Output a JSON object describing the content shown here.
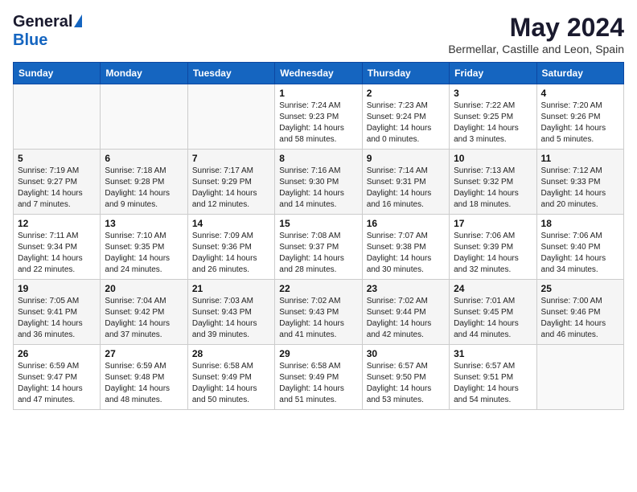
{
  "header": {
    "logo_general": "General",
    "logo_blue": "Blue",
    "month_year": "May 2024",
    "location": "Bermellar, Castille and Leon, Spain"
  },
  "weekdays": [
    "Sunday",
    "Monday",
    "Tuesday",
    "Wednesday",
    "Thursday",
    "Friday",
    "Saturday"
  ],
  "weeks": [
    [
      {
        "day": "",
        "info": ""
      },
      {
        "day": "",
        "info": ""
      },
      {
        "day": "",
        "info": ""
      },
      {
        "day": "1",
        "info": "Sunrise: 7:24 AM\nSunset: 9:23 PM\nDaylight: 14 hours\nand 58 minutes."
      },
      {
        "day": "2",
        "info": "Sunrise: 7:23 AM\nSunset: 9:24 PM\nDaylight: 14 hours\nand 0 minutes."
      },
      {
        "day": "3",
        "info": "Sunrise: 7:22 AM\nSunset: 9:25 PM\nDaylight: 14 hours\nand 3 minutes."
      },
      {
        "day": "4",
        "info": "Sunrise: 7:20 AM\nSunset: 9:26 PM\nDaylight: 14 hours\nand 5 minutes."
      }
    ],
    [
      {
        "day": "5",
        "info": "Sunrise: 7:19 AM\nSunset: 9:27 PM\nDaylight: 14 hours\nand 7 minutes."
      },
      {
        "day": "6",
        "info": "Sunrise: 7:18 AM\nSunset: 9:28 PM\nDaylight: 14 hours\nand 9 minutes."
      },
      {
        "day": "7",
        "info": "Sunrise: 7:17 AM\nSunset: 9:29 PM\nDaylight: 14 hours\nand 12 minutes."
      },
      {
        "day": "8",
        "info": "Sunrise: 7:16 AM\nSunset: 9:30 PM\nDaylight: 14 hours\nand 14 minutes."
      },
      {
        "day": "9",
        "info": "Sunrise: 7:14 AM\nSunset: 9:31 PM\nDaylight: 14 hours\nand 16 minutes."
      },
      {
        "day": "10",
        "info": "Sunrise: 7:13 AM\nSunset: 9:32 PM\nDaylight: 14 hours\nand 18 minutes."
      },
      {
        "day": "11",
        "info": "Sunrise: 7:12 AM\nSunset: 9:33 PM\nDaylight: 14 hours\nand 20 minutes."
      }
    ],
    [
      {
        "day": "12",
        "info": "Sunrise: 7:11 AM\nSunset: 9:34 PM\nDaylight: 14 hours\nand 22 minutes."
      },
      {
        "day": "13",
        "info": "Sunrise: 7:10 AM\nSunset: 9:35 PM\nDaylight: 14 hours\nand 24 minutes."
      },
      {
        "day": "14",
        "info": "Sunrise: 7:09 AM\nSunset: 9:36 PM\nDaylight: 14 hours\nand 26 minutes."
      },
      {
        "day": "15",
        "info": "Sunrise: 7:08 AM\nSunset: 9:37 PM\nDaylight: 14 hours\nand 28 minutes."
      },
      {
        "day": "16",
        "info": "Sunrise: 7:07 AM\nSunset: 9:38 PM\nDaylight: 14 hours\nand 30 minutes."
      },
      {
        "day": "17",
        "info": "Sunrise: 7:06 AM\nSunset: 9:39 PM\nDaylight: 14 hours\nand 32 minutes."
      },
      {
        "day": "18",
        "info": "Sunrise: 7:06 AM\nSunset: 9:40 PM\nDaylight: 14 hours\nand 34 minutes."
      }
    ],
    [
      {
        "day": "19",
        "info": "Sunrise: 7:05 AM\nSunset: 9:41 PM\nDaylight: 14 hours\nand 36 minutes."
      },
      {
        "day": "20",
        "info": "Sunrise: 7:04 AM\nSunset: 9:42 PM\nDaylight: 14 hours\nand 37 minutes."
      },
      {
        "day": "21",
        "info": "Sunrise: 7:03 AM\nSunset: 9:43 PM\nDaylight: 14 hours\nand 39 minutes."
      },
      {
        "day": "22",
        "info": "Sunrise: 7:02 AM\nSunset: 9:43 PM\nDaylight: 14 hours\nand 41 minutes."
      },
      {
        "day": "23",
        "info": "Sunrise: 7:02 AM\nSunset: 9:44 PM\nDaylight: 14 hours\nand 42 minutes."
      },
      {
        "day": "24",
        "info": "Sunrise: 7:01 AM\nSunset: 9:45 PM\nDaylight: 14 hours\nand 44 minutes."
      },
      {
        "day": "25",
        "info": "Sunrise: 7:00 AM\nSunset: 9:46 PM\nDaylight: 14 hours\nand 46 minutes."
      }
    ],
    [
      {
        "day": "26",
        "info": "Sunrise: 6:59 AM\nSunset: 9:47 PM\nDaylight: 14 hours\nand 47 minutes."
      },
      {
        "day": "27",
        "info": "Sunrise: 6:59 AM\nSunset: 9:48 PM\nDaylight: 14 hours\nand 48 minutes."
      },
      {
        "day": "28",
        "info": "Sunrise: 6:58 AM\nSunset: 9:49 PM\nDaylight: 14 hours\nand 50 minutes."
      },
      {
        "day": "29",
        "info": "Sunrise: 6:58 AM\nSunset: 9:49 PM\nDaylight: 14 hours\nand 51 minutes."
      },
      {
        "day": "30",
        "info": "Sunrise: 6:57 AM\nSunset: 9:50 PM\nDaylight: 14 hours\nand 53 minutes."
      },
      {
        "day": "31",
        "info": "Sunrise: 6:57 AM\nSunset: 9:51 PM\nDaylight: 14 hours\nand 54 minutes."
      },
      {
        "day": "",
        "info": ""
      }
    ]
  ]
}
